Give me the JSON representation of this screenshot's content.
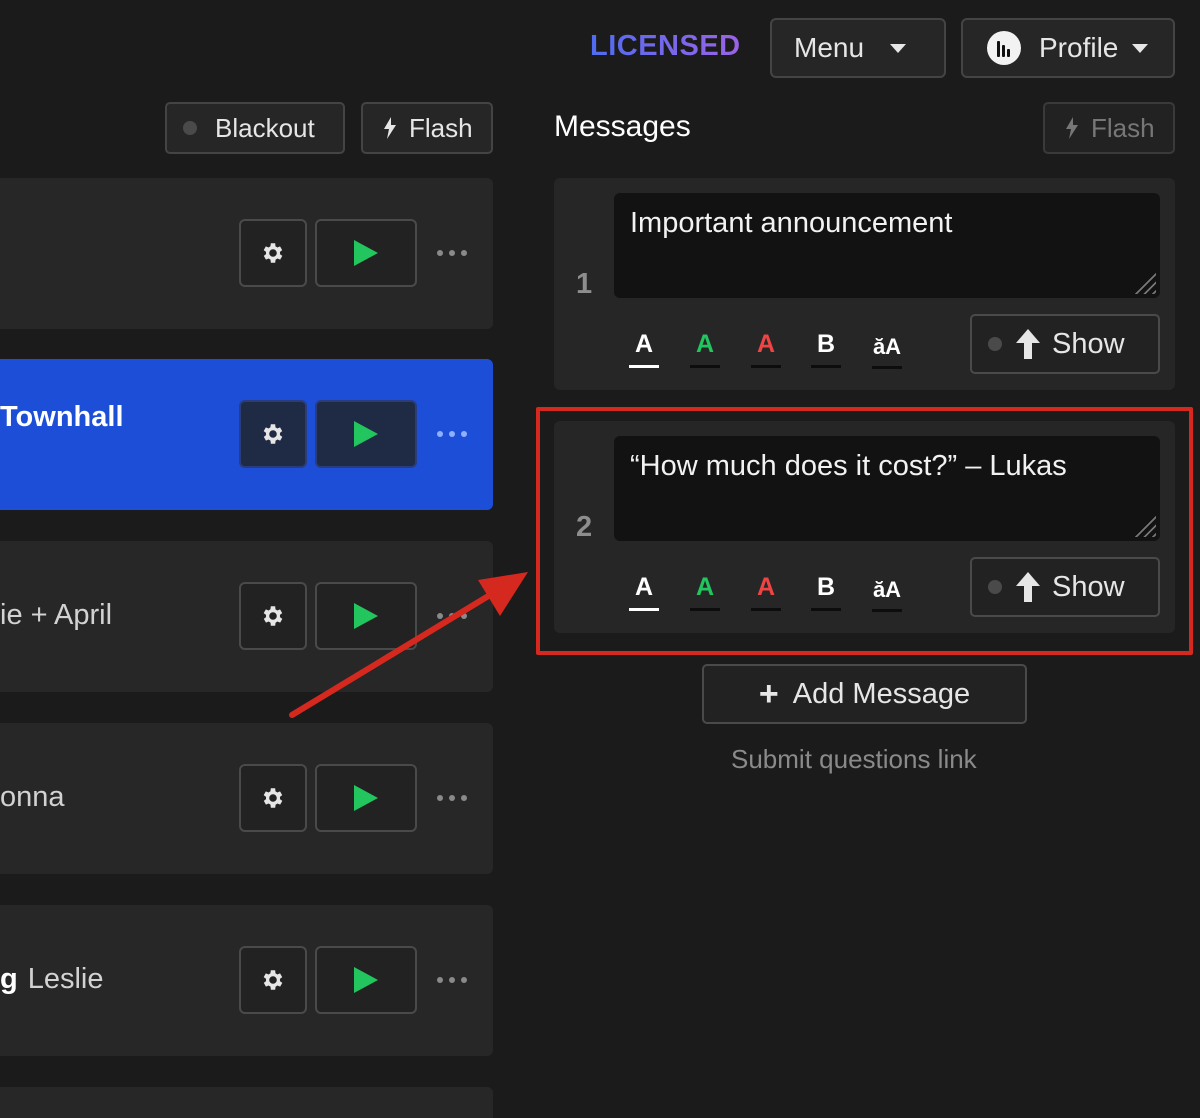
{
  "header": {
    "license_label": "LICENSED",
    "menu_label": "Menu",
    "profile_label": "Profile"
  },
  "controls": {
    "blackout_label": "Blackout",
    "flash_label": "Flash"
  },
  "timers": [
    {
      "title": "",
      "active": false
    },
    {
      "title": "Townhall",
      "active": true
    },
    {
      "title": "ie + April",
      "active": false
    },
    {
      "title": "onna",
      "active": false
    },
    {
      "title_bold": "g",
      "title": "Leslie",
      "active": false
    }
  ],
  "messages_panel": {
    "title": "Messages",
    "flash_label": "Flash",
    "messages": [
      {
        "number": "1",
        "text": "Important announcement",
        "show_label": "Show"
      },
      {
        "number": "2",
        "text": "“How much does it cost?” – Lukas",
        "show_label": "Show"
      }
    ],
    "format_options": {
      "white": "A",
      "green": "A",
      "red": "A",
      "bold": "B",
      "case": "ăA"
    },
    "add_message_label": "Add Message",
    "submit_link": "Submit questions link"
  },
  "colors": {
    "background": "#1b1b1b",
    "card": "#262626",
    "active_row": "#1d4ed8",
    "play_green": "#22c55e",
    "format_red": "#ef4444",
    "annotation_red": "#d5281f"
  },
  "icons": [
    "gear-icon",
    "play-icon",
    "more-icon",
    "flash-icon",
    "up-arrow-icon",
    "caret-down-icon",
    "plus-icon"
  ]
}
